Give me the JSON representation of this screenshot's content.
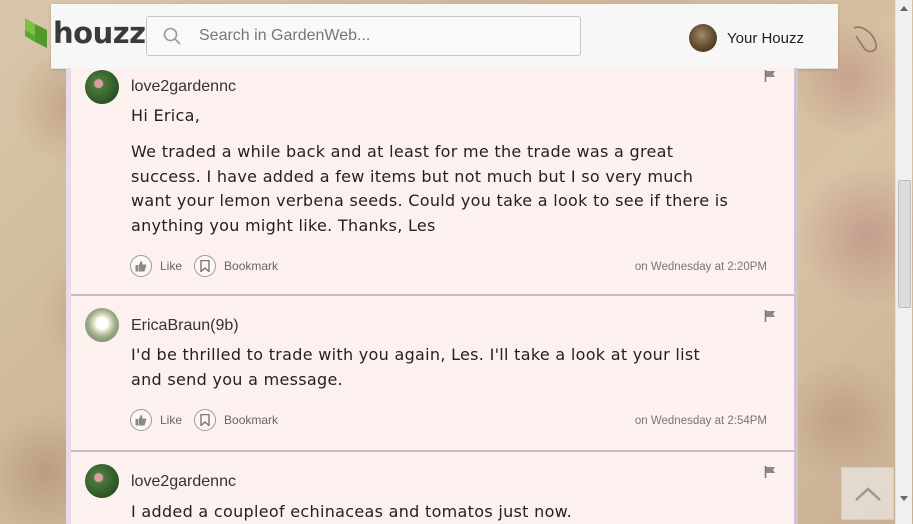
{
  "header": {
    "logo_text": "houzz",
    "search_placeholder": "Search in GardenWeb...",
    "your_houzz_label": "Your Houzz"
  },
  "posts": [
    {
      "username": "love2gardennc",
      "greeting": "Hi Erica,",
      "body": "We traded a while back and at least for me the trade was a great success. I have added a few items but not much but I so very much want your lemon verbena seeds. Could you take a look to see if there is anything you might like. Thanks, Les",
      "like_label": "Like",
      "bookmark_label": "Bookmark",
      "timestamp": "on Wednesday at 2:20PM"
    },
    {
      "username": "EricaBraun",
      "zone": "(9b)",
      "body": "I'd be thrilled to trade with you again, Les. I'll take a look at your list and send you a message.",
      "like_label": "Like",
      "bookmark_label": "Bookmark",
      "timestamp": "on Wednesday at 2:54PM"
    },
    {
      "username": "love2gardennc",
      "body": "I added a coupleof echinaceas and tomatos just now."
    }
  ],
  "colors": {
    "content_bg": "#fdf1ef",
    "divider": "#c9b8c6",
    "logo_green": "#6ab04c"
  }
}
